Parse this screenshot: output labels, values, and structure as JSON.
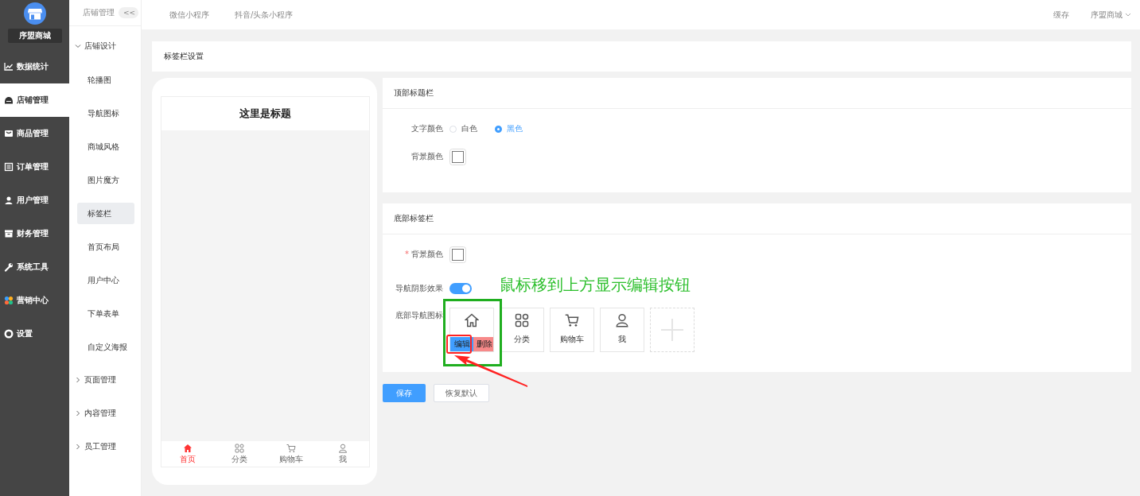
{
  "sidebar": {
    "store_name": "序盟商城",
    "items": [
      {
        "label": "数据统计",
        "selected": false
      },
      {
        "label": "店铺管理",
        "selected": true
      },
      {
        "label": "商品管理",
        "selected": false
      },
      {
        "label": "订单管理",
        "selected": false
      },
      {
        "label": "用户管理",
        "selected": false
      },
      {
        "label": "财务管理",
        "selected": false
      },
      {
        "label": "系统工具",
        "selected": false
      },
      {
        "label": "营销中心",
        "selected": false
      },
      {
        "label": "设置",
        "selected": false
      }
    ]
  },
  "subnav": {
    "title": "店铺管理",
    "toggle": "<<",
    "groups": [
      {
        "label": "店铺设计",
        "expanded": true,
        "children": [
          {
            "label": "轮播图",
            "selected": false
          },
          {
            "label": "导航图标",
            "selected": false
          },
          {
            "label": "商城风格",
            "selected": false
          },
          {
            "label": "图片魔方",
            "selected": false
          },
          {
            "label": "标签栏",
            "selected": true
          },
          {
            "label": "首页布局",
            "selected": false
          },
          {
            "label": "用户中心",
            "selected": false
          },
          {
            "label": "下单表单",
            "selected": false
          },
          {
            "label": "自定义海报",
            "selected": false
          }
        ]
      },
      {
        "label": "页面管理",
        "expanded": false
      },
      {
        "label": "内容管理",
        "expanded": false
      },
      {
        "label": "员工管理",
        "expanded": false
      }
    ]
  },
  "topbar": {
    "tabs": [
      {
        "label": "微信小程序"
      },
      {
        "label": "抖音/头条小程序"
      }
    ],
    "actions": [
      {
        "label": "缓存",
        "kind": "link"
      },
      {
        "label": "序盟商城",
        "kind": "dropdown"
      }
    ]
  },
  "page_title": "标签栏设置",
  "preview": {
    "title": "这里是标题",
    "tabs": [
      {
        "label": "首页",
        "selected": true
      },
      {
        "label": "分类",
        "selected": false
      },
      {
        "label": "购物车",
        "selected": false
      },
      {
        "label": "我",
        "selected": false
      }
    ]
  },
  "top_panel": {
    "title": "顶部标题栏",
    "text_color": {
      "label": "文字颜色",
      "options": [
        {
          "label": "白色",
          "selected": false
        },
        {
          "label": "黑色",
          "selected": true
        }
      ]
    },
    "background": {
      "label": "背景颜色"
    }
  },
  "bottom_panel": {
    "title": "底部标签栏",
    "background": {
      "label": "背景颜色",
      "required_mark": "*"
    },
    "shadow": {
      "label": "导航阴影效果",
      "on": true
    },
    "icons": {
      "label": "底部导航图标",
      "items": [
        {
          "kind": "hovered",
          "actions": [
            "编辑",
            "删除"
          ]
        },
        {
          "kind": "item",
          "label": "分类"
        },
        {
          "kind": "item",
          "label": "购物车"
        },
        {
          "kind": "item",
          "label": "我"
        },
        {
          "kind": "add"
        }
      ]
    }
  },
  "buttons": [
    {
      "label": "保存",
      "kind": "primary"
    },
    {
      "label": "恢复默认",
      "kind": "default"
    }
  ],
  "annotation": {
    "text": "鼠标移到上方显示编辑按钮"
  }
}
